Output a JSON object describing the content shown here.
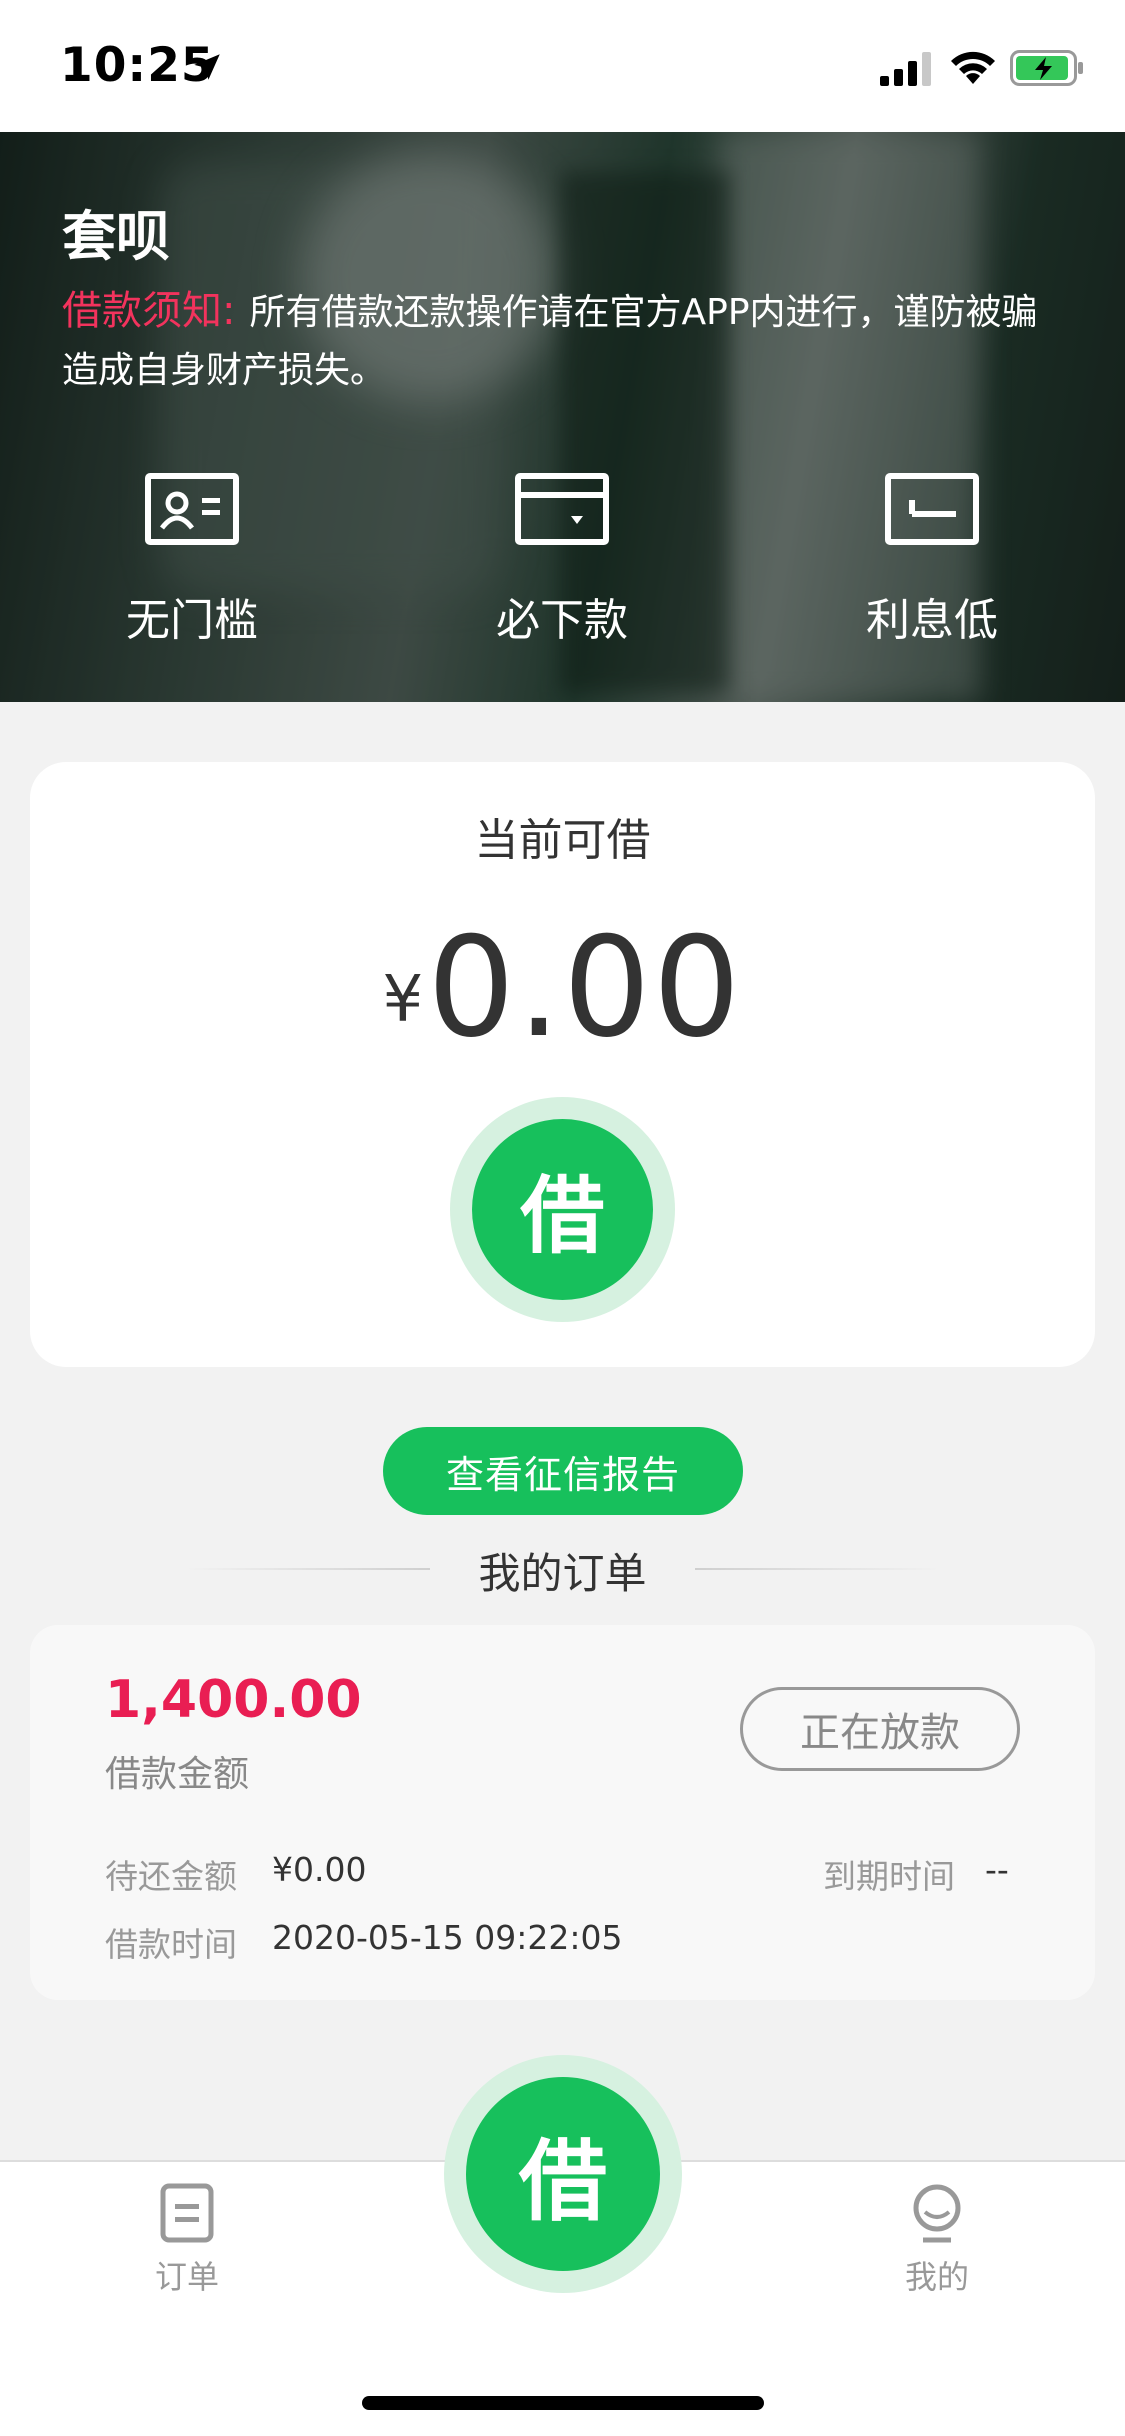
{
  "status_bar": {
    "time": "10:25"
  },
  "hero": {
    "title": "套呗",
    "notice_label": "借款须知:",
    "notice_text": "所有借款还款操作请在官方APP内进行，谨防被骗造成自身财产损失。",
    "features": [
      {
        "icon": "id-card-icon",
        "label": "无门槛"
      },
      {
        "icon": "wallet-icon",
        "label": "必下款"
      },
      {
        "icon": "return-arrow-icon",
        "label": "利息低"
      }
    ]
  },
  "borrow_card": {
    "title": "当前可借",
    "currency": "¥",
    "amount": "0.00",
    "button_label": "借"
  },
  "credit_report_button": "查看征信报告",
  "orders_section": {
    "title": "我的订单",
    "order": {
      "amount": "1,400.00",
      "amount_label": "借款金额",
      "status": "正在放款",
      "pending_label": "待还金额",
      "pending_value": "¥0.00",
      "due_label": "到期时间",
      "due_value": "--",
      "borrow_time_label": "借款时间",
      "borrow_time_value": "2020-05-15 09:22:05"
    }
  },
  "tab_bar": {
    "orders_label": "订单",
    "center_label": "借",
    "mine_label": "我的"
  },
  "colors": {
    "primary_green": "#17c05c",
    "accent_red": "#e91e53",
    "notice_red": "#f2335d"
  }
}
